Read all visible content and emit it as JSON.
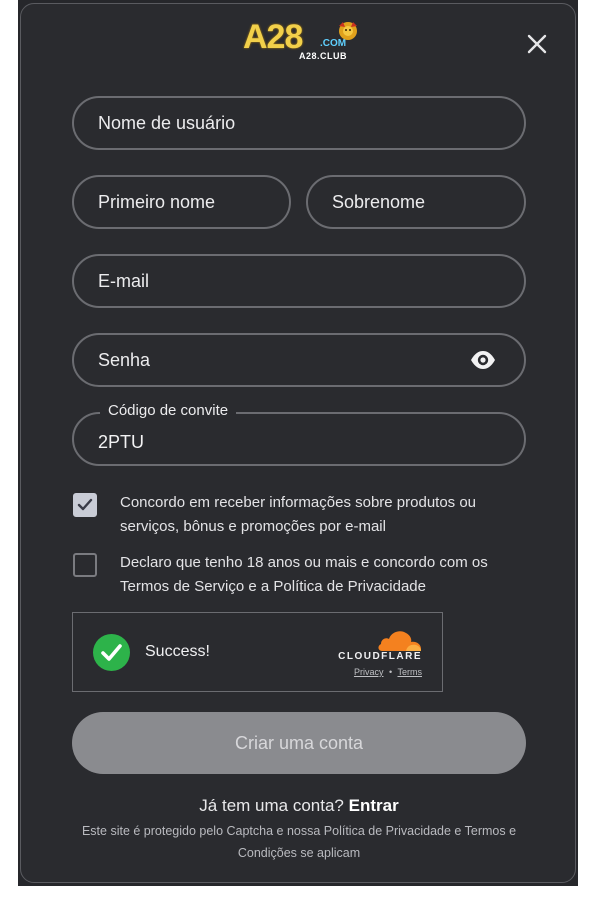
{
  "brand": {
    "logo_main": "A28",
    "logo_com": ".COM",
    "logo_club": "A28.CLUB",
    "accent_gold": "#f2d04a"
  },
  "form": {
    "username_placeholder": "Nome de usuário",
    "first_name_placeholder": "Primeiro nome",
    "last_name_placeholder": "Sobrenome",
    "email_placeholder": "E-mail",
    "password_placeholder": "Senha",
    "invite_label": "Código de convite",
    "invite_value": "2PTU"
  },
  "consent": {
    "marketing_text": "Concordo em receber informações sobre produtos ou serviços, bônus e promoções por e-mail",
    "marketing_checked": true,
    "terms_text": "Declaro que tenho 18 anos ou mais e concordo com os Termos de Serviço e a Política de Privacidade",
    "terms_checked": false
  },
  "captcha": {
    "status": "Success!",
    "brand": "CLOUDFLARE",
    "privacy": "Privacy",
    "separator": "•",
    "terms": "Terms",
    "success_color": "#2db34a",
    "cloud_color": "#f4811f"
  },
  "submit_label": "Criar uma conta",
  "footer": {
    "have_account": "Já tem uma conta?",
    "login_link": "Entrar",
    "legal": "Este site é protegido pelo Captcha e nossa Política de Privacidade e Termos e Condições se aplicam"
  },
  "icons": {
    "close": "close-icon",
    "eye": "eye-icon",
    "check": "checkmark-icon"
  }
}
